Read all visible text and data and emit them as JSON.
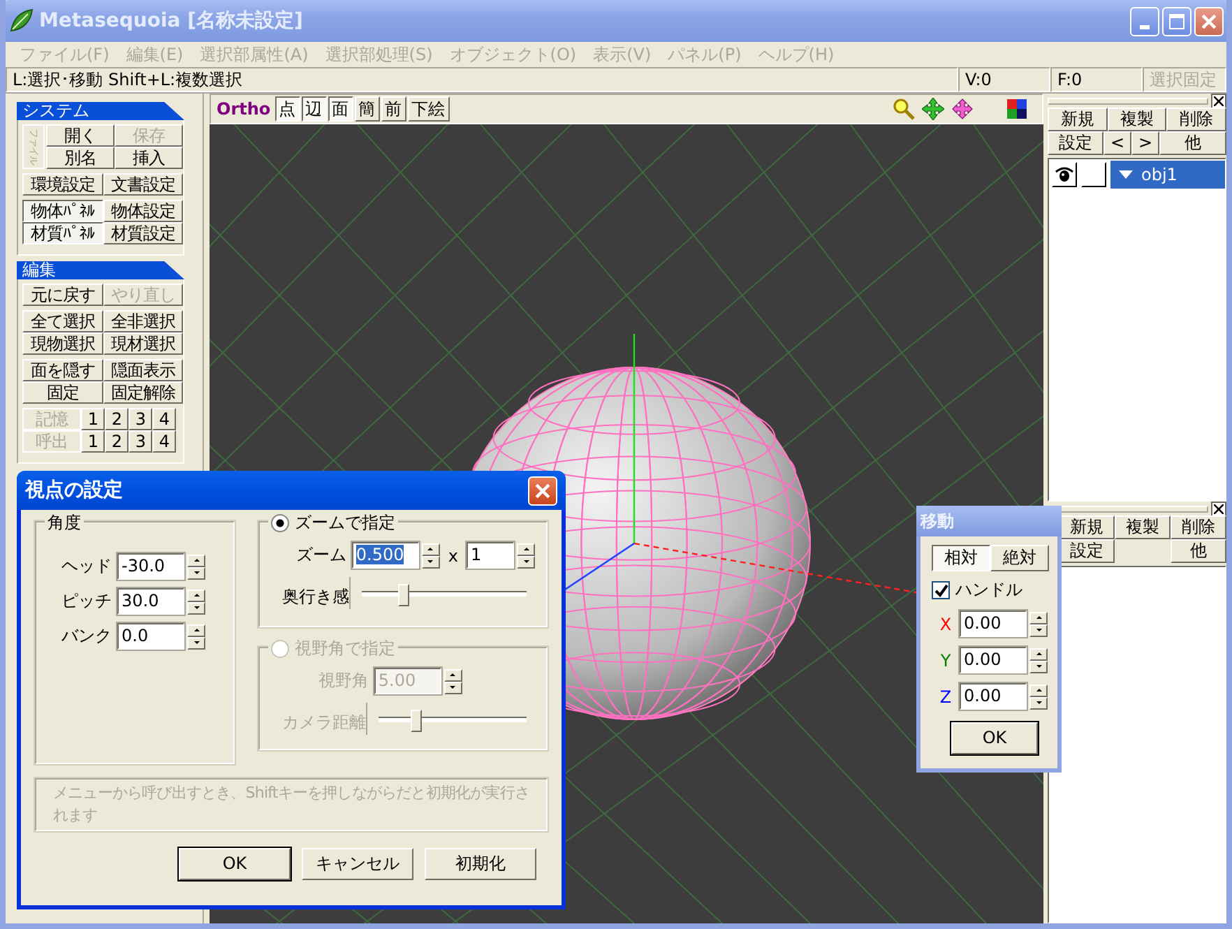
{
  "window": {
    "title": "Metasequoia [名称未設定]"
  },
  "menu": [
    {
      "label": "ファイル(F)",
      "disabled": true
    },
    {
      "label": "編集(E)",
      "disabled": true
    },
    {
      "label": "選択部属性(A)",
      "disabled": true
    },
    {
      "label": "選択部処理(S)",
      "disabled": true
    },
    {
      "label": "オブジェクト(O)",
      "disabled": true
    },
    {
      "label": "表示(V)",
      "disabled": true
    },
    {
      "label": "パネル(P)",
      "disabled": true
    },
    {
      "label": "ヘルプ(H)",
      "disabled": true
    }
  ],
  "status_bar": {
    "hint": "L:選択･移動 Shift+L:複数選択",
    "vertices": "V:0",
    "faces": "F:0",
    "lock_button": {
      "label": "選択固定",
      "disabled": true
    }
  },
  "left_panel": [
    {
      "title": "システム",
      "groups": [
        {
          "side_label": {
            "label": "ファイル",
            "disabled": true
          },
          "rows": [
            [
              {
                "label": "開く",
                "disabled": false,
                "pressed": false
              },
              {
                "label": "保存",
                "disabled": true,
                "pressed": false
              }
            ],
            [
              {
                "label": "別名",
                "disabled": false,
                "pressed": false
              },
              {
                "label": "挿入",
                "disabled": false,
                "pressed": false
              }
            ]
          ]
        },
        {
          "rows": [
            [
              {
                "label": "環境設定",
                "disabled": false,
                "pressed": false
              },
              {
                "label": "文書設定",
                "disabled": false,
                "pressed": false
              }
            ]
          ]
        },
        {
          "rows": [
            [
              {
                "label": "物体ﾊﾟﾈﾙ",
                "disabled": false,
                "pressed": true
              },
              {
                "label": "物体設定",
                "disabled": false,
                "pressed": false
              }
            ],
            [
              {
                "label": "材質ﾊﾟﾈﾙ",
                "disabled": false,
                "pressed": true
              },
              {
                "label": "材質設定",
                "disabled": false,
                "pressed": false
              }
            ]
          ]
        }
      ]
    },
    {
      "title": "編集",
      "groups": [
        {
          "rows": [
            [
              {
                "label": "元に戻す",
                "disabled": false,
                "pressed": false
              },
              {
                "label": "やり直し",
                "disabled": true,
                "pressed": false
              }
            ]
          ]
        },
        {
          "rows": [
            [
              {
                "label": "全て選択",
                "disabled": false,
                "pressed": false
              },
              {
                "label": "全非選択",
                "disabled": false,
                "pressed": false
              }
            ],
            [
              {
                "label": "現物選択",
                "disabled": false,
                "pressed": false
              },
              {
                "label": "現材選択",
                "disabled": false,
                "pressed": false
              }
            ]
          ]
        },
        {
          "rows": [
            [
              {
                "label": "面を隠す",
                "disabled": false,
                "pressed": false
              },
              {
                "label": "隠面表示",
                "disabled": false,
                "pressed": false
              }
            ],
            [
              {
                "label": "固定",
                "disabled": false,
                "pressed": false
              },
              {
                "label": "固定解除",
                "disabled": false,
                "pressed": false
              }
            ]
          ]
        },
        {
          "rows": [
            [
              {
                "label": "記憶",
                "disabled": true,
                "pressed": false
              },
              {
                "label": "1",
                "disabled": false,
                "pressed": false
              },
              {
                "label": "2",
                "disabled": false,
                "pressed": false
              },
              {
                "label": "3",
                "disabled": false,
                "pressed": false
              },
              {
                "label": "4",
                "disabled": false,
                "pressed": false
              }
            ],
            [
              {
                "label": "呼出",
                "disabled": true,
                "pressed": false
              },
              {
                "label": "1",
                "disabled": false,
                "pressed": false
              },
              {
                "label": "2",
                "disabled": false,
                "pressed": false
              },
              {
                "label": "3",
                "disabled": false,
                "pressed": false
              },
              {
                "label": "4",
                "disabled": false,
                "pressed": false
              }
            ]
          ]
        }
      ]
    }
  ],
  "viewport_toolbar": {
    "mode": "Ortho",
    "buttons": [
      {
        "label": "点",
        "pressed": true
      },
      {
        "label": "辺",
        "pressed": true
      },
      {
        "label": "面",
        "pressed": true
      },
      {
        "label": "簡",
        "pressed": false
      },
      {
        "label": "前",
        "pressed": false
      },
      {
        "label": "下絵",
        "pressed": false
      }
    ]
  },
  "object_panel": {
    "buttons": [
      [
        {
          "label": "新規"
        },
        {
          "label": "複製"
        },
        {
          "label": "削除"
        }
      ],
      [
        {
          "label": "設定"
        },
        {
          "label": "<"
        },
        {
          "label": ">"
        },
        {
          "label": "他"
        }
      ]
    ],
    "objects": [
      {
        "name": "obj1",
        "visible": true,
        "locked": false,
        "expanded": true,
        "selected": true
      }
    ]
  },
  "material_panel": {
    "buttons": [
      [
        {
          "label": "新規"
        },
        {
          "label": "複製"
        },
        {
          "label": "削除"
        }
      ],
      [
        {
          "label": "設定"
        },
        {
          "label": "他"
        }
      ]
    ]
  },
  "viewpoint_dialog": {
    "title": "視点の設定",
    "angle_group": {
      "title": "角度",
      "fields": [
        {
          "label": "ヘッド",
          "value": "-30.0"
        },
        {
          "label": "ピッチ",
          "value": "30.0"
        },
        {
          "label": "バンク",
          "value": "0.0"
        }
      ]
    },
    "zoom_group": {
      "label": "ズームで指定",
      "selected": true,
      "zoom": {
        "label": "ズーム",
        "value": "0.500",
        "highlighted": true,
        "sign": "x",
        "multiplier": "1"
      },
      "depth": {
        "label": "奥行き感",
        "level": 0.25
      }
    },
    "fov_group": {
      "label": "視野角で指定",
      "selected": false,
      "disabled": true,
      "fov": {
        "label": "視野角",
        "value": "5.00"
      },
      "distance": {
        "label": "カメラ距離",
        "level": 0.25
      }
    },
    "note": "メニューから呼び出すとき、Shiftキーを押しながらだと初期化が実行されます",
    "buttons": [
      {
        "label": "OK",
        "default": true
      },
      {
        "label": "キャンセル",
        "default": false
      },
      {
        "label": "初期化",
        "default": false
      }
    ]
  },
  "move_dialog": {
    "title": "移動",
    "modes": [
      {
        "label": "相対",
        "selected": true
      },
      {
        "label": "絶対",
        "selected": false
      }
    ],
    "handle": {
      "label": "ハンドル",
      "checked": true
    },
    "axes": [
      {
        "label": "X",
        "color": "#ff0000",
        "value": "0.00"
      },
      {
        "label": "Y",
        "color": "#008000",
        "value": "0.00"
      },
      {
        "label": "Z",
        "color": "#0000ff",
        "value": "0.00"
      }
    ],
    "ok": "OK"
  }
}
